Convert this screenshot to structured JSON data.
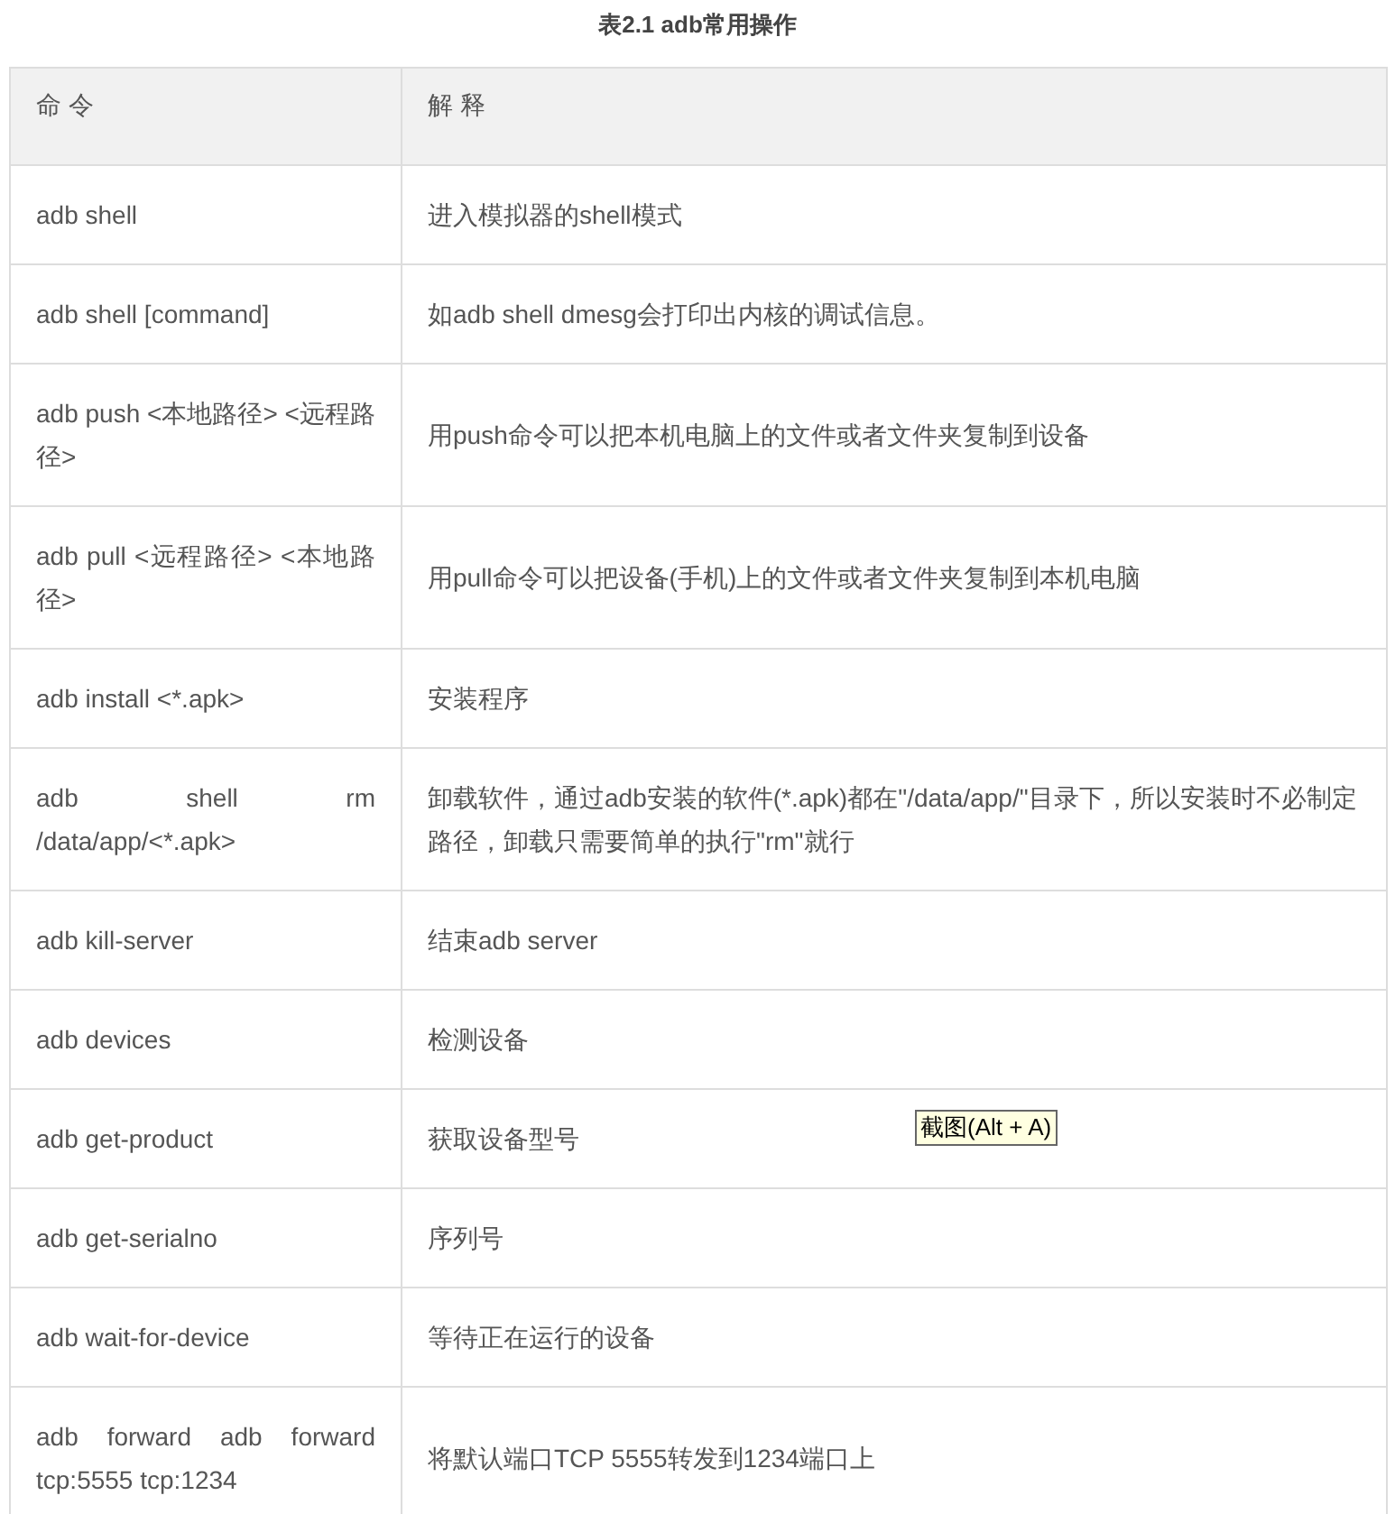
{
  "caption": "表2.1 adb常用操作",
  "table": {
    "columns": [
      "命 令",
      "解 释"
    ],
    "rows": [
      {
        "command": "adb shell",
        "description": "进入模拟器的shell模式"
      },
      {
        "command": "adb shell [command]",
        "description": "如adb shell dmesg会打印出内核的调试信息。"
      },
      {
        "command": "adb push <本地路径> <远程路径>",
        "description": "用push命令可以把本机电脑上的文件或者文件夹复制到设备"
      },
      {
        "command": "adb pull <远程路径> <本地路径>",
        "description": "用pull命令可以把设备(手机)上的文件或者文件夹复制到本机电脑"
      },
      {
        "command": "adb install <*.apk>",
        "description": "安装程序"
      },
      {
        "command": "adb shell rm /data/app/<*.apk>",
        "description": "卸载软件，通过adb安装的软件(*.apk)都在\"/data/app/\"目录下，所以安装时不必制定路径，卸载只需要简单的执行\"rm\"就行"
      },
      {
        "command": "adb kill-server",
        "description": "结束adb server"
      },
      {
        "command": "adb devices",
        "description": "检测设备"
      },
      {
        "command": "adb get-product",
        "description": "获取设备型号"
      },
      {
        "command": "adb get-serialno",
        "description": "序列号"
      },
      {
        "command": "adb wait-for-device",
        "description": "等待正在运行的设备"
      },
      {
        "command": "adb forward adb forward tcp:5555 tcp:1234",
        "description": "将默认端口TCP 5555转发到1234端口上"
      }
    ]
  },
  "tooltip": {
    "text": "截图(Alt + A)"
  }
}
